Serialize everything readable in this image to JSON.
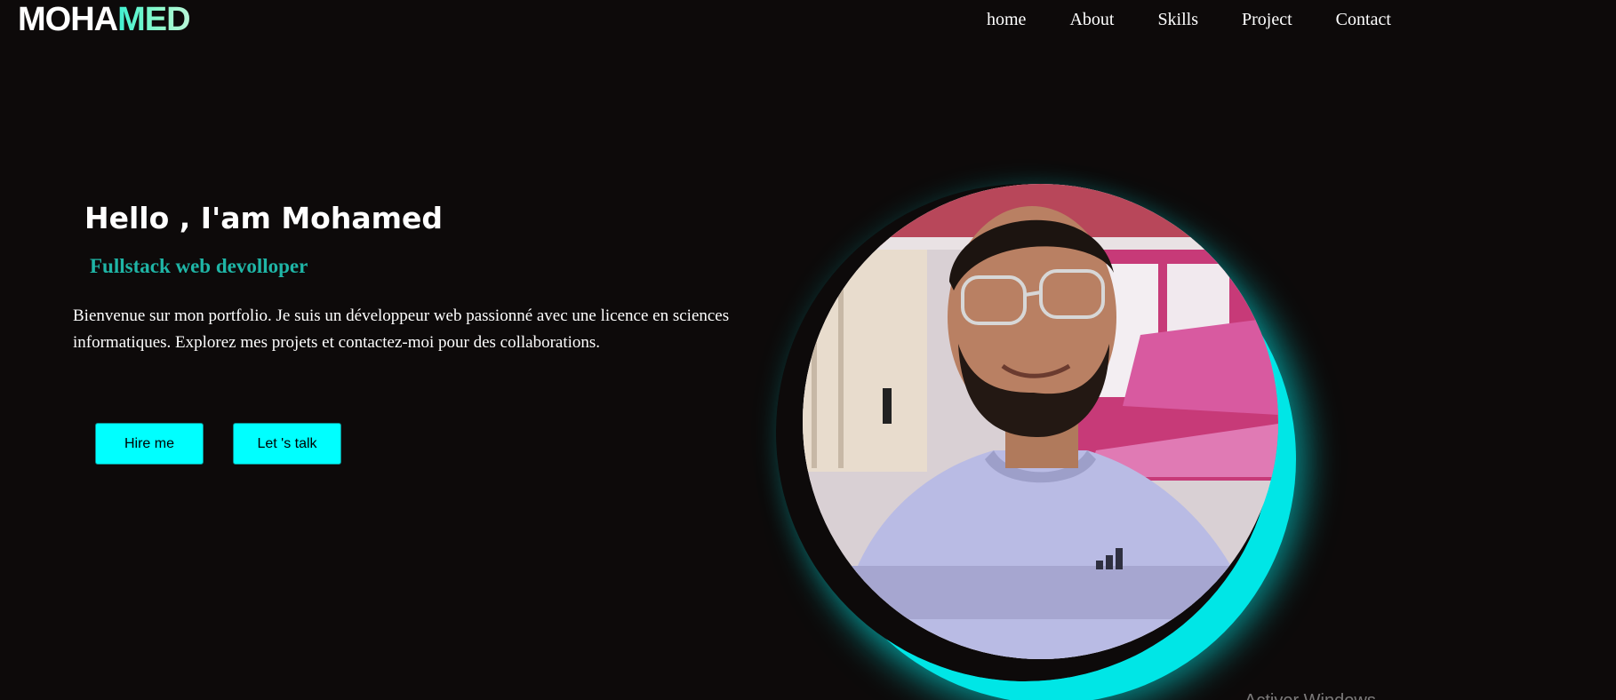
{
  "brand": {
    "logo_part1": "MOHA",
    "logo_part2": "MED",
    "accent_color": "#7ef5c8"
  },
  "nav": {
    "items": [
      {
        "label": "home"
      },
      {
        "label": "About"
      },
      {
        "label": "Skills"
      },
      {
        "label": "Project"
      },
      {
        "label": "Contact"
      }
    ]
  },
  "hero": {
    "title": "Hello , I'am Mohamed",
    "subtitle": "Fullstack web devolloper",
    "subtitle_color": "#1fb5a6",
    "description": "Bienvenue sur mon portfolio. Je suis un développeur web passionné avec une licence en sciences informatiques. Explorez mes projets et contactez-moi pour des collaborations.",
    "buttons": {
      "hire": "Hire me",
      "talk": "Let 's talk"
    },
    "button_color": "#00ffff"
  },
  "portrait": {
    "image": "profile-photo",
    "glow_color": "#00ffff"
  },
  "watermark": {
    "text": "Activer Windows"
  },
  "theme": {
    "background": "#0d0a0a",
    "text": "#ffffff"
  }
}
